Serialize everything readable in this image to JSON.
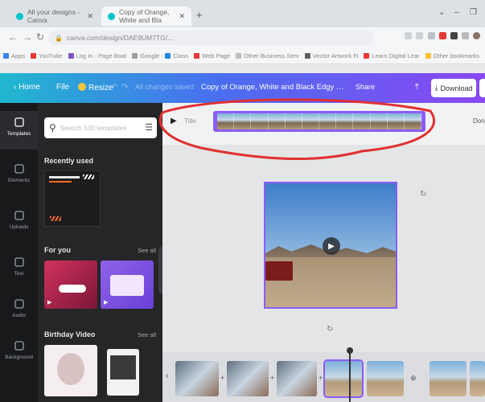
{
  "browser": {
    "tabs": [
      {
        "label": "All your designs - Canva"
      },
      {
        "label": "Copy of Orange, White and Bla"
      }
    ],
    "url": "canva.com/design/DAE9UM7TG/..."
  },
  "bookmarks": [
    {
      "label": "Apps",
      "color": "#3b82f6"
    },
    {
      "label": "YouTube",
      "color": "#e53935"
    },
    {
      "label": "Log In - Page Boat",
      "color": "#7e57c2"
    },
    {
      "label": "Google",
      "color": "#9e9e9e"
    },
    {
      "label": "Class",
      "color": "#1e88e5"
    },
    {
      "label": "Web Page",
      "color": "#e53935"
    },
    {
      "label": "Other Business Serv",
      "color": "#bdbdbd"
    },
    {
      "label": "Vector Artwork Fi",
      "color": "#616161"
    },
    {
      "label": "Learn Digital Lear",
      "color": "#e53935"
    },
    {
      "label": "Other bookmarks",
      "color": "#fbc02d"
    },
    {
      "label": "Reading list",
      "color": "#757575"
    }
  ],
  "header": {
    "home": "Home",
    "file": "File",
    "resize": "Resize",
    "saved": "All changes saved",
    "doc_title": "Copy of Orange, White and Black Edgy Maximalist Health",
    "share": "Share",
    "download": "Download"
  },
  "rail": [
    {
      "label": "Templates",
      "icon": "templates-icon",
      "active": true
    },
    {
      "label": "Elements",
      "icon": "elements-icon"
    },
    {
      "label": "Uploads",
      "icon": "uploads-icon"
    },
    {
      "label": "Text",
      "icon": "text-icon"
    },
    {
      "label": "Audio",
      "icon": "audio-icon"
    },
    {
      "label": "Background",
      "icon": "background-icon"
    }
  ],
  "panel": {
    "search_placeholder": "Search 100 templates",
    "recently_used": "Recently used",
    "for_you": "For you",
    "birthday": "Birthday Video",
    "see_all": "See all"
  },
  "timeline": {
    "title": "Title",
    "done": "Done"
  },
  "colors": {
    "accent": "#8b5cf6",
    "highlight": "#e03131"
  }
}
